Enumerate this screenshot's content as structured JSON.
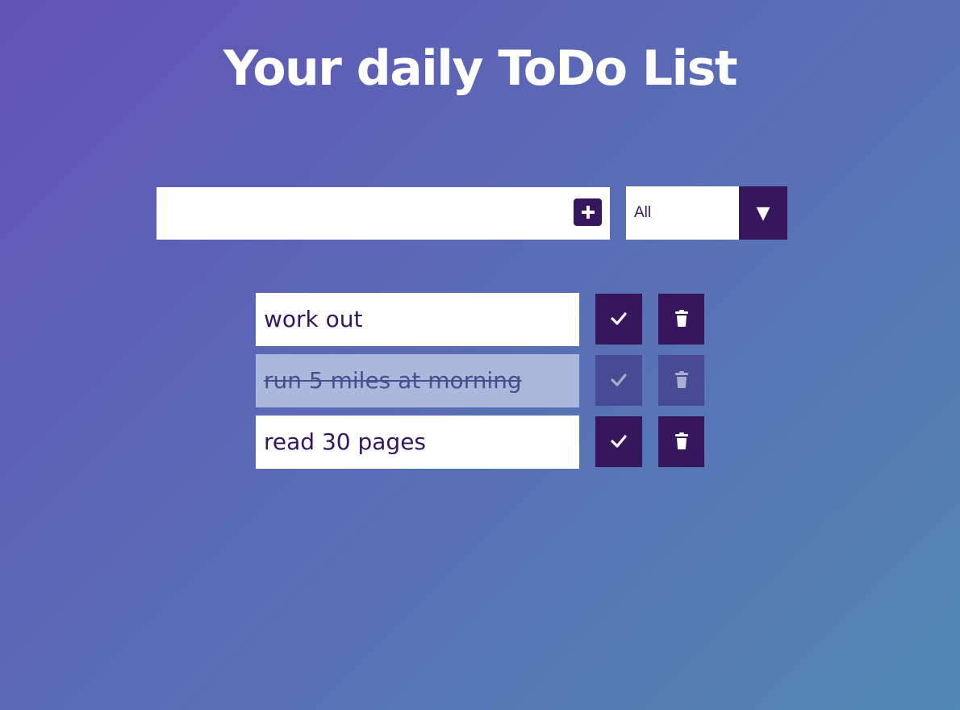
{
  "header": {
    "title": "Your daily ToDo List"
  },
  "form": {
    "input_value": "",
    "input_placeholder": "",
    "add_icon": "plus-icon",
    "filter": {
      "selected": "All",
      "arrow": "▼"
    }
  },
  "todos": [
    {
      "text": "work out",
      "completed": false
    },
    {
      "text": "run 5 miles at morning",
      "completed": true
    },
    {
      "text": "read 30 pages",
      "completed": false
    }
  ],
  "colors": {
    "accent": "#36175e",
    "completed_bg": "#abb7db",
    "completed_btn": "#484a93"
  }
}
